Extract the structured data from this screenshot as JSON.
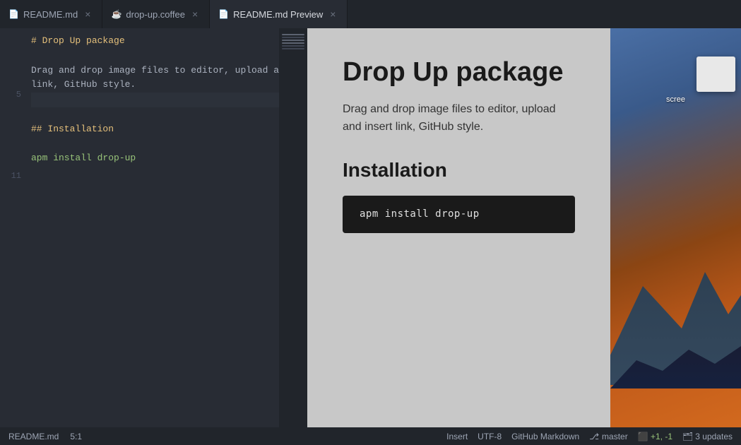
{
  "tabs": [
    {
      "id": "readme-md",
      "label": "README.md",
      "icon": "📄",
      "active": false,
      "closable": true,
      "modified": false
    },
    {
      "id": "drop-up-coffee",
      "label": "drop-up.coffee",
      "icon": "☕",
      "active": false,
      "closable": true,
      "modified": false
    },
    {
      "id": "readme-preview",
      "label": "README.md Preview",
      "icon": "📄",
      "active": true,
      "closable": true,
      "modified": false
    }
  ],
  "editor": {
    "lines": [
      {
        "num": "",
        "text": "# Drop Up package",
        "type": "heading"
      },
      {
        "num": "",
        "text": "",
        "type": "normal"
      },
      {
        "num": "",
        "text": "Drag and drop image files to editor, upload and insert",
        "type": "normal"
      },
      {
        "num": "",
        "text": "link, GitHub style.",
        "type": "normal"
      },
      {
        "num": "5",
        "text": "",
        "type": "highlighted"
      },
      {
        "num": "",
        "text": "",
        "type": "normal"
      },
      {
        "num": "",
        "text": "## Installation",
        "type": "subheading"
      },
      {
        "num": "",
        "text": "",
        "type": "normal"
      },
      {
        "num": "",
        "text": "apm install drop-up",
        "type": "code"
      },
      {
        "num": "",
        "text": "",
        "type": "normal"
      },
      {
        "num": "11",
        "text": "",
        "type": "normal"
      }
    ]
  },
  "preview": {
    "title": "Drop Up package",
    "description": "Drag and drop image files to editor, upload and insert link, GitHub style.",
    "installation_label": "Installation",
    "code_block": "apm install drop-up"
  },
  "desktop": {
    "screen_label": "scree"
  },
  "status_bar": {
    "file": "README.md",
    "position": "5:1",
    "insert": "Insert",
    "encoding": "UTF-8",
    "syntax": "GitHub Markdown",
    "branch_icon": "⎇",
    "branch": "master",
    "changes": "+1, -1",
    "updates": "3 updates"
  }
}
